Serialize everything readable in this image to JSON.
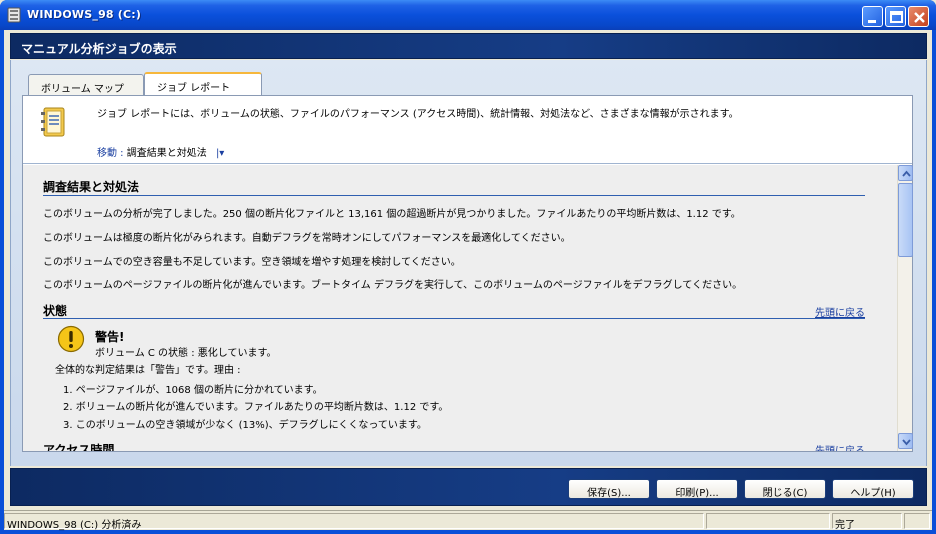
{
  "window": {
    "title": "WINDOWS_98 (C:)"
  },
  "header": {
    "title": "マニュアル分析ジョブの表示"
  },
  "tabs": [
    {
      "label": "ボリューム マップ",
      "active": false
    },
    {
      "label": "ジョブ レポート",
      "active": true
    }
  ],
  "info": {
    "description": "ジョブ レポートには、ボリュームの状態、ファイルのパフォーマンス (アクセス時間)、統計情報、対処法など、さまざまな情報が示されます。",
    "goto_label": "移動 :",
    "goto_value": "調査結果と対処法"
  },
  "report": {
    "findings": {
      "title": "調査結果と対処法",
      "paragraphs": [
        "このボリュームの分析が完了しました。250 個の断片化ファイルと 13,161 個の超過断片が見つかりました。ファイルあたりの平均断片数は、1.12 です。",
        "このボリュームは極度の断片化がみられます。自動デフラグを常時オンにしてパフォーマンスを最適化してください。",
        "このボリュームでの空き容量も不足しています。空き領域を増やす処理を検討してください。",
        "このボリュームのページファイルの断片化が進んでいます。ブートタイム デフラグを実行して、このボリュームのページファイルをデフラグしてください。"
      ]
    },
    "status": {
      "title": "状態",
      "back_to_top": "先頭に戻る",
      "warning_title": "警告!",
      "warning_subtitle": "ボリューム C の状態 : 悪化しています。",
      "overall": "全体的な判定結果は「警告」です。理由 :",
      "reasons": [
        "1. ページファイルが、1068 個の断片に分かれています。",
        "2. ボリュームの断片化が進んでいます。ファイルあたりの平均断片数は、1.12 です。",
        "3. このボリュームの空き領域が少なく (13%)、デフラグしにくくなっています。"
      ]
    },
    "access": {
      "title": "アクセス時間",
      "back_to_top": "先頭に戻る"
    }
  },
  "buttons": {
    "save": "保存(S)...",
    "print": "印刷(P)...",
    "close": "閉じる(C)",
    "help": "ヘルプ(H)"
  },
  "statusbar": {
    "left": "WINDOWS_98 (C:) 分析済み",
    "right": "完了"
  },
  "colors": {
    "titlebar": "#0a50db",
    "header_band": "#163d86",
    "link": "#1a3fa0",
    "rule": "#2f5fb0"
  }
}
